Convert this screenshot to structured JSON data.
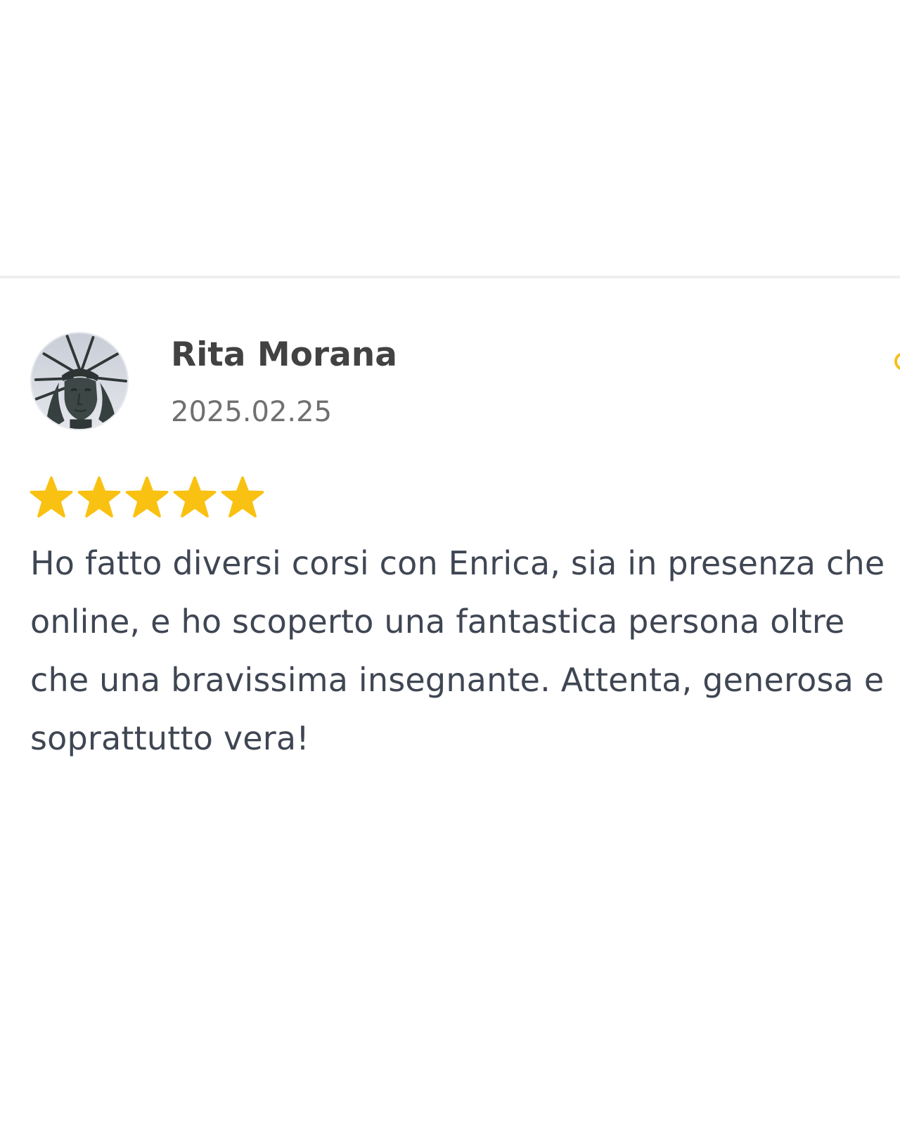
{
  "review": {
    "reviewer_name": "Rita Morana",
    "date": "2025.02.25",
    "rating": 5,
    "rating_max": 5,
    "text": "Ho fatto diversi corsi con Enrica, sia in presenza che online, e ho scoperto una fantastica persona oltre che una bravissima insegnante. Attenta, generosa e soprattutto vera!",
    "avatar_icon": "statue-of-liberty-avatar"
  },
  "colors": {
    "star": "#f9c112",
    "name": "#424242",
    "date": "#707070",
    "body_text": "#3f4653",
    "divider": "#eeeeee"
  }
}
